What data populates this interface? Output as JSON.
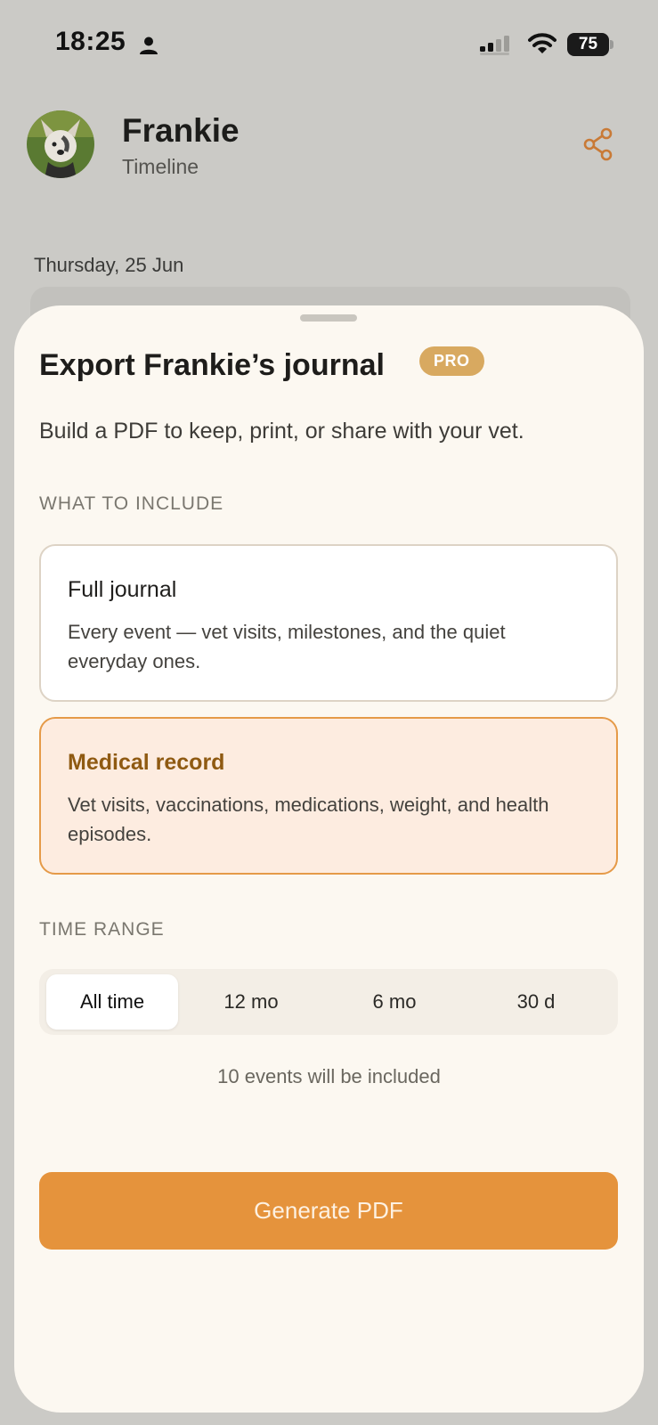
{
  "status_bar": {
    "time": "18:25",
    "battery": "75"
  },
  "header": {
    "pet_name": "Frankie",
    "subtitle": "Timeline"
  },
  "timeline": {
    "date_label": "Thursday, 25 Jun"
  },
  "sheet": {
    "title": "Export Frankie’s journal",
    "badge": "PRO",
    "subtitle": "Build a PDF to keep, print, or share with your vet.",
    "include_label": "WHAT TO INCLUDE",
    "options": [
      {
        "title": "Full journal",
        "description": "Every event — vet visits, milestones, and the quiet everyday ones.",
        "selected": false
      },
      {
        "title": "Medical record",
        "description": "Vet visits, vaccinations, medications, weight, and health episodes.",
        "selected": true
      }
    ],
    "range_label": "TIME RANGE",
    "ranges": [
      "All time",
      "12 mo",
      "6 mo",
      "30 d"
    ],
    "selected_range": "All time",
    "count_text": "10 events will be included",
    "generate_label": "Generate PDF"
  },
  "colors": {
    "accent": "#e5933c",
    "badge": "#d8a960",
    "selected_border": "#e59a48",
    "selected_bg": "#fdece0",
    "sheet_bg": "#fcf8f1"
  },
  "icons": {
    "share": "share-icon",
    "person": "person-icon",
    "signal": "signal-icon",
    "wifi": "wifi-icon"
  }
}
